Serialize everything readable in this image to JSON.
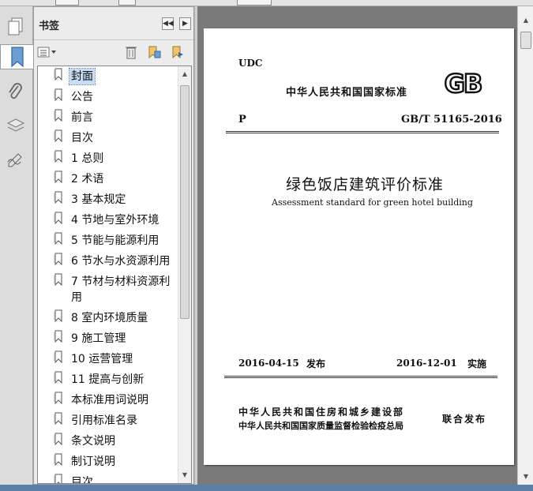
{
  "panel": {
    "title": "书签",
    "bookmarks": [
      {
        "label": "封面"
      },
      {
        "label": "公告"
      },
      {
        "label": "前言"
      },
      {
        "label": "目次"
      },
      {
        "label": "1 总则"
      },
      {
        "label": "2 术语"
      },
      {
        "label": "3 基本规定"
      },
      {
        "label": "4 节地与室外环境"
      },
      {
        "label": "5 节能与能源利用"
      },
      {
        "label": "6 节水与水资源利用"
      },
      {
        "label": "7 节材与材料资源利用"
      },
      {
        "label": "8 室内环境质量"
      },
      {
        "label": "9 施工管理"
      },
      {
        "label": "10 运营管理"
      },
      {
        "label": "11 提高与创新"
      },
      {
        "label": "本标准用词说明"
      },
      {
        "label": "引用标准名录"
      },
      {
        "label": "条文说明"
      },
      {
        "label": "制订说明"
      },
      {
        "label": "目次"
      }
    ]
  },
  "document": {
    "udc": "UDC",
    "header_org": "中华人民共和国国家标准",
    "logo_text": "GB",
    "category": "P",
    "standard_no": "GB/T 51165-2016",
    "title_cn": "绿色饭店建筑评价标准",
    "title_en": "Assessment standard for green hotel building",
    "issue_date": "2016-04-15",
    "issue_label": "发布",
    "effective_date": "2016-12-01",
    "effective_label": "实施",
    "issuer1": "中华人民共和国住房和城乡建设部",
    "issuer2": "中华人民共和国国家质量监督检验检疫总局",
    "joint_label": "联合发布"
  },
  "colors": {
    "selected_bg": "#c8dcf4",
    "doc_bg": "#7a7a7a",
    "panel_bg": "#ececec"
  }
}
